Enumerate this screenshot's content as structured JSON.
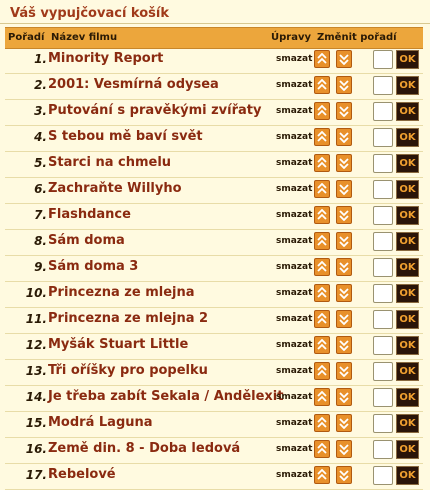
{
  "page": {
    "title": "Váš vypujčovací košík"
  },
  "table_header": {
    "order": "Pořadí",
    "title": "Název filmu",
    "edits": "Úpravy",
    "change_order": "Změnit pořadí"
  },
  "labels": {
    "delete": "smazat",
    "ok": "OK"
  },
  "icons": {
    "up": "double-chevron-up-icon",
    "down": "double-chevron-down-icon"
  },
  "colors": {
    "accent": "#eca63c",
    "title_text": "#8a2a10",
    "ok_bg": "#2a1408",
    "ok_text": "#f0a030"
  },
  "films": [
    {
      "num": "1.",
      "title": "Minority Report"
    },
    {
      "num": "2.",
      "title": "2001: Vesmírná odysea"
    },
    {
      "num": "3.",
      "title": "Putování s pravěkými zvířaty"
    },
    {
      "num": "4.",
      "title": "S tebou mě baví svět"
    },
    {
      "num": "5.",
      "title": "Starci na chmelu"
    },
    {
      "num": "6.",
      "title": "Zachraňte Willyho"
    },
    {
      "num": "7.",
      "title": "Flashdance"
    },
    {
      "num": "8.",
      "title": "Sám doma"
    },
    {
      "num": "9.",
      "title": "Sám doma 3"
    },
    {
      "num": "10.",
      "title": "Princezna ze mlejna"
    },
    {
      "num": "11.",
      "title": "Princezna ze mlejna 2"
    },
    {
      "num": "12.",
      "title": "Myšák Stuart Little"
    },
    {
      "num": "13.",
      "title": "Tři oříšky pro popelku"
    },
    {
      "num": "14.",
      "title": "Je třeba zabít Sekala / Andělexit"
    },
    {
      "num": "15.",
      "title": "Modrá Laguna"
    },
    {
      "num": "16.",
      "title": "Země din. 8 - Doba ledová"
    },
    {
      "num": "17.",
      "title": "Rebelové"
    }
  ]
}
